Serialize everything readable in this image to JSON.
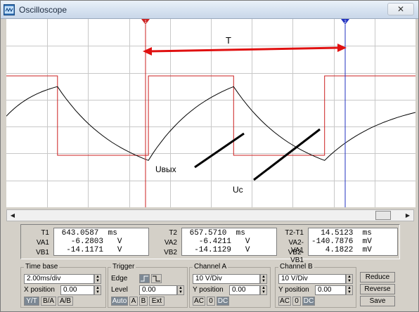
{
  "window": {
    "title": "Oscilloscope",
    "close_glyph": "✕"
  },
  "colors": {
    "channel_a": "#cc2020",
    "channel_b": "#000000",
    "grid": "#c8c8c8",
    "cursor_1": "#cc2020",
    "cursor_2": "#2030c0",
    "annotation": "#e01010"
  },
  "screen": {
    "cursor_1_label": "1",
    "cursor_2_label": "2",
    "annotations": {
      "period": "T",
      "output": "Uвых",
      "capacitor": "Uc"
    }
  },
  "chart_data": {
    "type": "line",
    "xlabel": "",
    "ylabel": "",
    "series": [
      {
        "name": "",
        "kind": "square",
        "values": [
          [
            0,
            1
          ],
          [
            0.9,
            1
          ],
          [
            0.9,
            -1
          ],
          [
            2.5,
            -1
          ],
          [
            2.5,
            1
          ],
          [
            4.0,
            1
          ],
          [
            4.0,
            -1
          ],
          [
            5.6,
            -1
          ],
          [
            5.6,
            1
          ],
          [
            7.2,
            1
          ]
        ]
      },
      {
        "name": "",
        "kind": "exponential",
        "values": [
          [
            0,
            0.15
          ],
          [
            0.9,
            0.55
          ],
          [
            2.5,
            -0.45
          ],
          [
            4.0,
            0.55
          ],
          [
            5.6,
            -0.45
          ],
          [
            7.2,
            0.2
          ]
        ]
      }
    ]
  },
  "scroll": {
    "left_arrow": "◀",
    "right_arrow": "▶"
  },
  "readouts": {
    "block1": {
      "labels": [
        "T1",
        "VA1",
        "VB1"
      ],
      "values": [
        " 643.0587  ms",
        "   -6.2803   V",
        "  -14.1171   V"
      ]
    },
    "block2": {
      "labels": [
        "T2",
        "VA2",
        "VB2"
      ],
      "values": [
        " 657.5710  ms",
        "   -6.4211   V",
        "  -14.1129   V"
      ]
    },
    "block3": {
      "labels": [
        "T2-T1",
        "VA2-VA1",
        "VB2-VB1"
      ],
      "values": [
        "  14.5123  ms",
        "-140.7876  mV",
        "   4.1822  mV"
      ]
    }
  },
  "timebase": {
    "title": "Time base",
    "scale": "2.00ms/div",
    "xpos_label": "X position",
    "xpos": "0.00",
    "modes": [
      "Y/T",
      "B/A",
      "A/B"
    ]
  },
  "trigger": {
    "title": "Trigger",
    "edge_label": "Edge",
    "level_label": "Level",
    "level": "0.00",
    "buttons": [
      "Auto",
      "A",
      "B",
      "Ext"
    ]
  },
  "channel_a": {
    "title": "Channel A",
    "scale": "10 V/Div",
    "ypos_label": "Y position",
    "ypos": "0.00",
    "coupling": [
      "AC",
      "0",
      "DC"
    ]
  },
  "channel_b": {
    "title": "Channel B",
    "scale": "10 V/Div",
    "ypos_label": "Y position",
    "ypos": "0.00",
    "coupling": [
      "AC",
      "0",
      "DC"
    ]
  },
  "actions": {
    "reduce": "Reduce",
    "reverse": "Reverse",
    "save": "Save"
  }
}
